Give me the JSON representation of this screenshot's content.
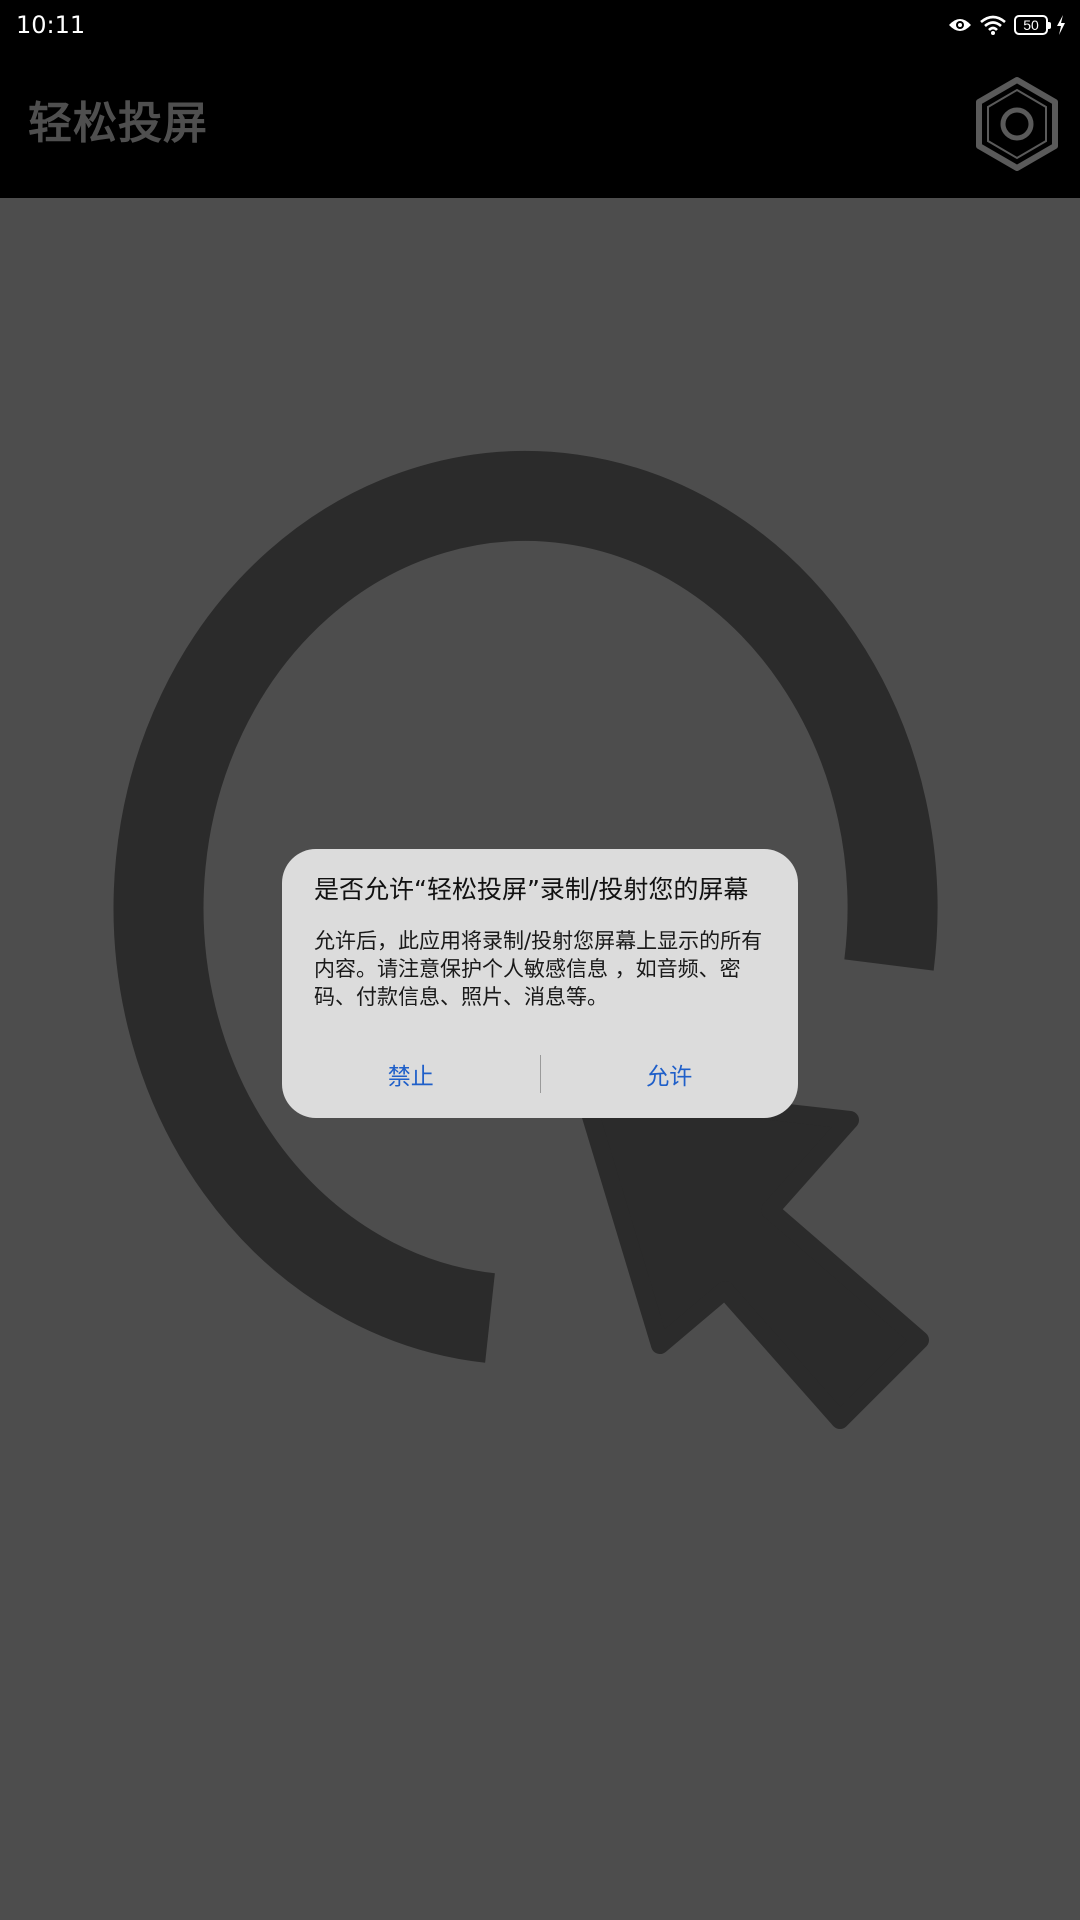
{
  "status_bar": {
    "time": "10:11",
    "battery_level": "50",
    "icons": [
      "eye-icon",
      "wifi-icon",
      "battery-icon",
      "charging-bolt-icon"
    ]
  },
  "app_bar": {
    "title": "轻松投屏",
    "settings_icon": "hexagon-settings-icon"
  },
  "background_graphic": {
    "icon": "screen-cast-cursor-icon",
    "color": "#2b2b2b"
  },
  "dialog": {
    "title": "是否允许“轻松投屏”录制/投射您的屏幕",
    "message": "允许后，此应用将录制/投射您屏幕上显示的所有内容。请注意保护个人敏感信息 ，如音频、密码、付款信息、照片、消息等。",
    "deny_label": "禁止",
    "allow_label": "允许",
    "button_color": "#1f5fc9"
  },
  "colors": {
    "top_bars": "#000000",
    "background": "#4d4d4d",
    "dialog": "#dcdcdc"
  }
}
